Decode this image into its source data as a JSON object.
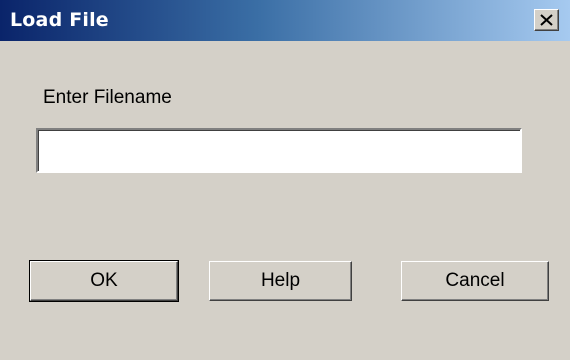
{
  "window": {
    "title": "Load File",
    "close_icon": "close-icon"
  },
  "form": {
    "label": "Enter Filename",
    "filename_value": "",
    "filename_placeholder": ""
  },
  "buttons": {
    "ok_label": "OK",
    "help_label": "Help",
    "cancel_label": "Cancel"
  },
  "colors": {
    "titlebar_start": "#0a246a",
    "titlebar_end": "#a6caf0",
    "dialog_background": "#d4d0c8"
  }
}
